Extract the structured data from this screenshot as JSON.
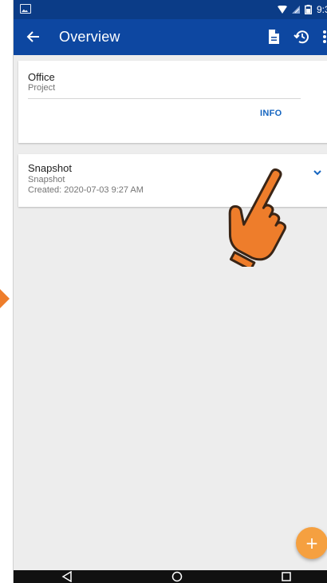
{
  "status_bar": {
    "time": "9:3",
    "icons": [
      "gallery-icon",
      "wifi-icon",
      "no-signal-icon",
      "battery-icon"
    ]
  },
  "app_bar": {
    "title": "Overview",
    "icons": [
      "back-arrow-icon",
      "document-icon",
      "history-icon",
      "more-vert-icon"
    ]
  },
  "project_card": {
    "title": "Office",
    "subtitle": "Project",
    "action_label": "INFO"
  },
  "snapshot_card": {
    "title": "Snapshot",
    "subtitle": "Snapshot",
    "created": "Created: 2020-07-03 9:27 AM",
    "expand_icon": "chevron-down-icon"
  },
  "fab": {
    "label": "+"
  },
  "nav_bar": {
    "icons": [
      "nav-back-icon",
      "nav-home-icon",
      "nav-recents-icon"
    ]
  },
  "colors": {
    "app_bar": "#0d47a1",
    "status_bar": "#0b3c87",
    "accent": "#1565c0",
    "fab": "#f5a040",
    "pointer": "#ee7d2b",
    "background": "#ededed"
  }
}
